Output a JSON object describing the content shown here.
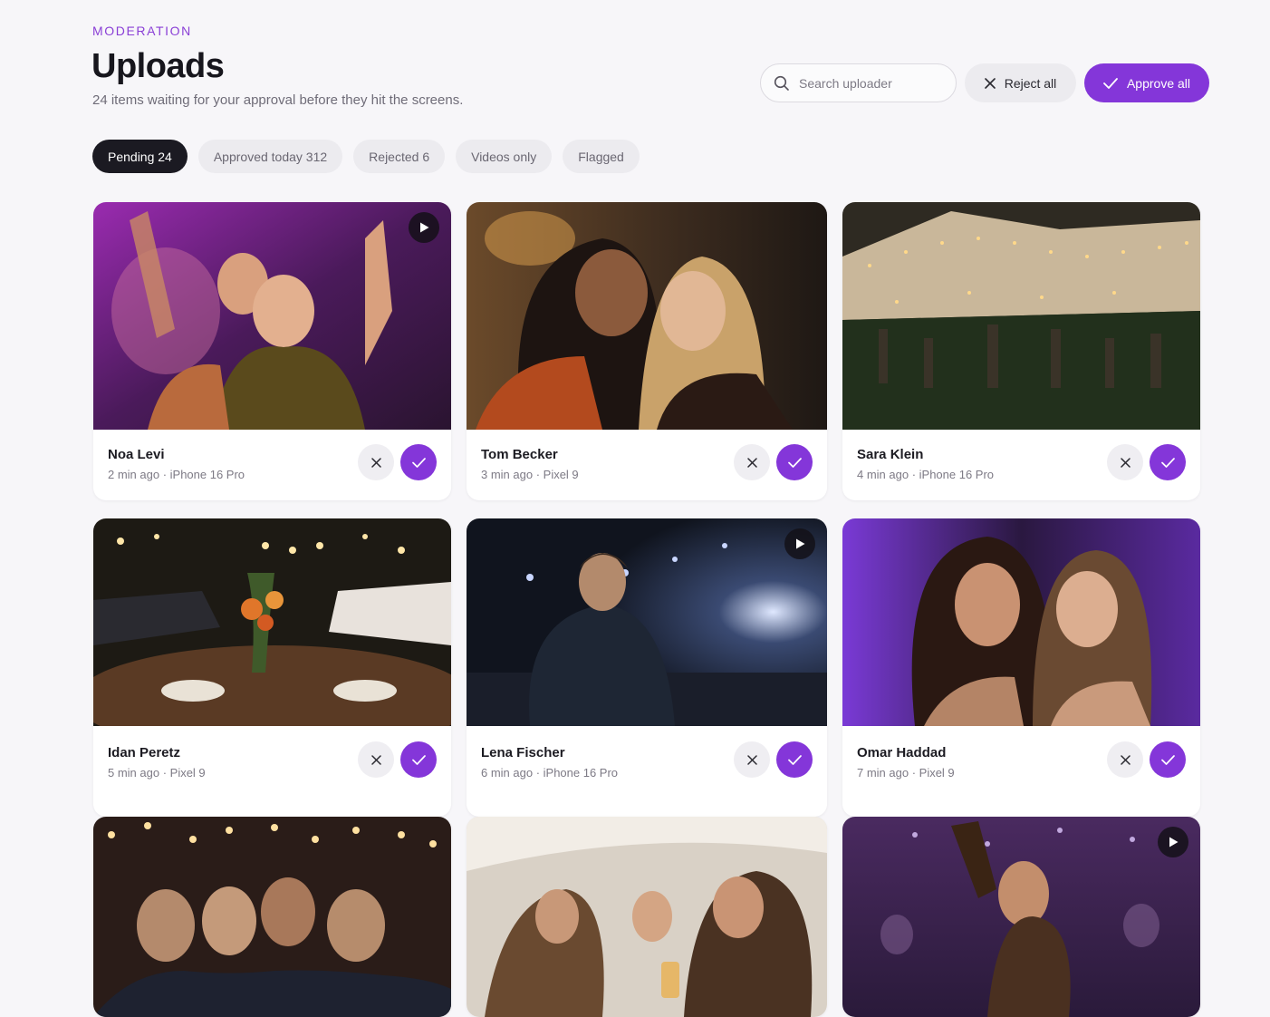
{
  "header": {
    "eyebrow": "MODERATION",
    "title": "Uploads",
    "subtitle": "24 items waiting for your approval before they hit the screens."
  },
  "search": {
    "placeholder": "Search uploader"
  },
  "actions": {
    "reject_all": "Reject all",
    "approve_all": "Approve all"
  },
  "tabs": [
    {
      "label": "Pending 24",
      "active": true
    },
    {
      "label": "Approved today 312",
      "active": false
    },
    {
      "label": "Rejected 6",
      "active": false
    },
    {
      "label": "Videos only",
      "active": false
    },
    {
      "label": "Flagged",
      "active": false
    }
  ],
  "uploads": [
    {
      "name": "Noa Levi",
      "info": "2 min ago · iPhone 16 Pro",
      "is_video": true
    },
    {
      "name": "Tom Becker",
      "info": "3 min ago · Pixel 9",
      "is_video": false
    },
    {
      "name": "Sara Klein",
      "info": "4 min ago · iPhone 16 Pro",
      "is_video": false
    },
    {
      "name": "Idan Peretz",
      "info": "5 min ago · Pixel 9",
      "is_video": false
    },
    {
      "name": "Lena Fischer",
      "info": "6 min ago · iPhone 16 Pro",
      "is_video": true
    },
    {
      "name": "Omar Haddad",
      "info": "7 min ago · Pixel 9",
      "is_video": false
    },
    {
      "is_video": false
    },
    {
      "is_video": false
    },
    {
      "is_video": true
    }
  ],
  "icons": {
    "search": "search-icon",
    "reject": "close-icon",
    "approve": "check-icon",
    "video": "play-icon"
  },
  "colors": {
    "accent": "#8436d9",
    "eyebrow": "#8a3fd6",
    "active_tab": "#1b1a22",
    "background": "#f7f6f9"
  }
}
